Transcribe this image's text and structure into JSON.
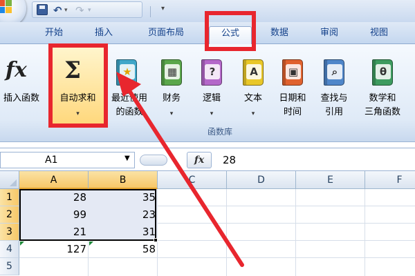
{
  "quick_access": {
    "customize_arrow": "▾"
  },
  "tabs": [
    {
      "label": "开始"
    },
    {
      "label": "插入"
    },
    {
      "label": "页面布局"
    },
    {
      "label": "公式",
      "active": true
    },
    {
      "label": "数据"
    },
    {
      "label": "审阅"
    },
    {
      "label": "视图"
    }
  ],
  "ribbon": {
    "group_label": "函数库",
    "buttons": [
      {
        "label": "插入函数"
      },
      {
        "label": "自动求和",
        "dropdown": "▾",
        "highlighted": true
      },
      {
        "label": "最近使用",
        "label2": "的函数"
      },
      {
        "label": "财务"
      },
      {
        "label": "逻辑"
      },
      {
        "label": "文本"
      },
      {
        "label": "日期和",
        "label2": "时间"
      },
      {
        "label": "查找与",
        "label2": "引用"
      },
      {
        "label": "数学和",
        "label2": "三角函数"
      }
    ],
    "book_glyphs": {
      "financial": "▦",
      "logical": "?",
      "text": "A",
      "datetime": "▣",
      "lookup": "⌕",
      "math": "θ"
    }
  },
  "formula_bar": {
    "name_box": "A1",
    "fx_label": "fx",
    "formula": "28"
  },
  "sheet": {
    "columns": [
      "A",
      "B",
      "C",
      "D",
      "E",
      "F"
    ],
    "rows": [
      "1",
      "2",
      "3",
      "4",
      "5"
    ],
    "cells": {
      "A1": "28",
      "B1": "35",
      "A2": "99",
      "B2": "23",
      "A3": "21",
      "B3": "31",
      "A4": "127",
      "B4": "58"
    }
  },
  "colors": {
    "annotation_red": "#e8262e",
    "accent_blue": "#15428b",
    "selection_orange": "#f7c768"
  }
}
